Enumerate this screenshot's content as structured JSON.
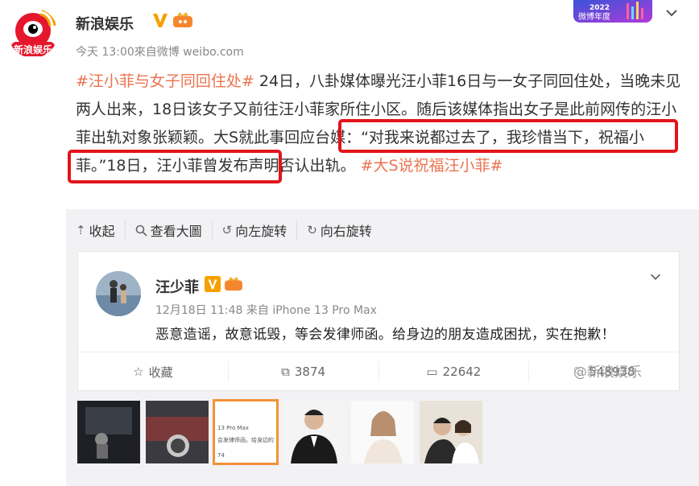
{
  "header": {
    "author": "新浪娱乐",
    "avatar_text": "新浪娱乐",
    "meta": "今天 13:00來自微博 weibo.com",
    "promo_year": "2022",
    "promo_text": "微博年度"
  },
  "post": {
    "tag1": "#汪小菲与女子同回住处#",
    "text1": " 24日，八卦媒体曝光汪小菲16日与一女子同回住处，当晚未见两人出来，18日该女子又前往汪小菲家所住小区。随后该媒体指出女子是此前网传的汪小菲出轨对象张颖颖。",
    "text2": "大S就此事回应台媒：“对我来说都过去了，我珍惜当下，祝福小菲。”",
    "text3": "18日，汪小菲曾发布声明否认出轨。",
    "tag2": "#大S说祝福汪小菲#"
  },
  "toolbar": {
    "collapse": "收起",
    "view_large": "查看大圖",
    "rotate_left": "向左旋转",
    "rotate_right": "向右旋转"
  },
  "card": {
    "name": "汪少菲",
    "meta": "12月18日 11:48 来自 iPhone 13 Pro Max",
    "text": "恶意造谣，故意诋毁，等会发律师函。给身边的朋友造成困扰，实在抱歉！",
    "fav": "收藏",
    "repost": "3874",
    "comment": "22642",
    "like": "548938"
  },
  "watermark": "@新浪娱乐",
  "thumb3": {
    "l1": "13 Pro Max",
    "l2": "会发律师函。给身边的",
    "l3": "74"
  },
  "colors": {
    "tag": "#eb7350",
    "highlight": "#e3141b",
    "selected": "#f29238"
  }
}
